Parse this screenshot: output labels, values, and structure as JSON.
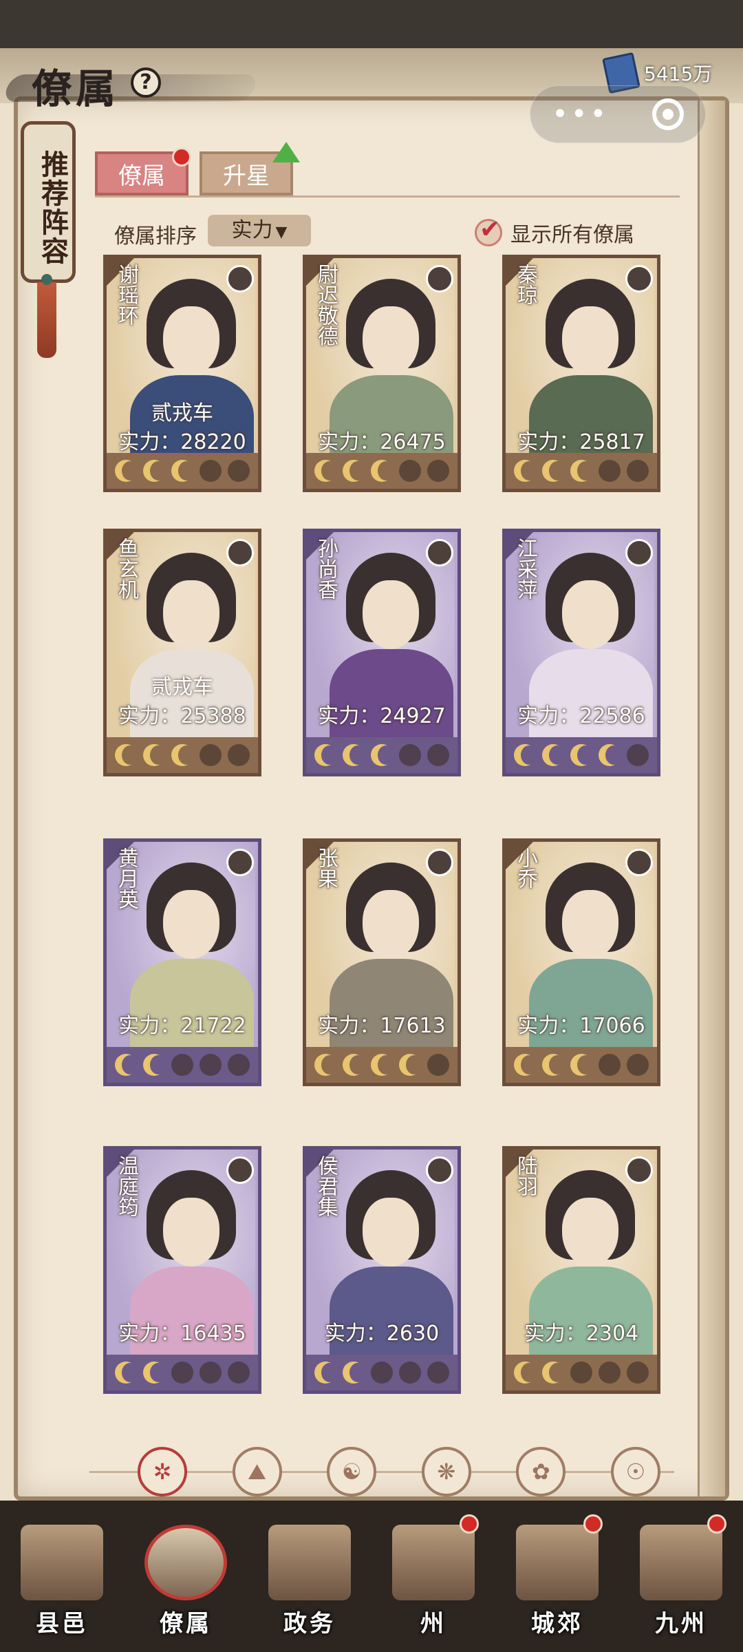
{
  "header": {
    "title": "僚属",
    "help_symbol": "?",
    "currency_value": "5415万",
    "capsule_dots": "•••"
  },
  "recommend_banner": "推荐阵容",
  "tabs": [
    {
      "label": "僚属",
      "active": true,
      "badge": "red-dot"
    },
    {
      "label": "升星",
      "active": false,
      "badge": "green-arrow"
    }
  ],
  "sort": {
    "label": "僚属排序",
    "selected": "实力"
  },
  "show_all": {
    "label": "显示所有僚属",
    "checked": true
  },
  "cards": [
    {
      "name": "谢瑶环",
      "tag": "贰戎车",
      "power": "实力：28220",
      "rarity": "gold",
      "stars_lit": 3,
      "stars_total": 5,
      "robe": "#3b4e7a"
    },
    {
      "name": "尉迟敬德",
      "tag": "",
      "power": "实力：26475",
      "rarity": "gold",
      "stars_lit": 3,
      "stars_total": 5,
      "robe": "#8a9a7c"
    },
    {
      "name": "秦琼",
      "tag": "",
      "power": "实力：25817",
      "rarity": "gold",
      "stars_lit": 3,
      "stars_total": 5,
      "robe": "#5a6b53"
    },
    {
      "name": "鱼玄机",
      "tag": "贰戎车",
      "power": "实力：25388",
      "rarity": "gold",
      "stars_lit": 3,
      "stars_total": 5,
      "robe": "#e8e0d8"
    },
    {
      "name": "孙尚香",
      "tag": "",
      "power": "实力：24927",
      "rarity": "purple",
      "stars_lit": 3,
      "stars_total": 5,
      "robe": "#6d4a8a"
    },
    {
      "name": "江采萍",
      "tag": "",
      "power": "实力：22586",
      "rarity": "purple",
      "stars_lit": 4,
      "stars_total": 5,
      "robe": "#e6dcea"
    },
    {
      "name": "黄月英",
      "tag": "",
      "power": "实力：21722",
      "rarity": "purple",
      "stars_lit": 2,
      "stars_total": 5,
      "robe": "#c8c59a"
    },
    {
      "name": "张果",
      "tag": "",
      "power": "实力：17613",
      "rarity": "gold",
      "stars_lit": 4,
      "stars_total": 5,
      "robe": "#8f8676"
    },
    {
      "name": "小乔",
      "tag": "",
      "power": "实力：17066",
      "rarity": "gold",
      "stars_lit": 3,
      "stars_total": 5,
      "robe": "#7fa594"
    },
    {
      "name": "温庭筠",
      "tag": "",
      "power": "实力：16435",
      "rarity": "purple",
      "stars_lit": 2,
      "stars_total": 5,
      "robe": "#d8a6c6"
    },
    {
      "name": "侯君集",
      "tag": "",
      "power": "实力：2630",
      "rarity": "purple",
      "stars_lit": 2,
      "stars_total": 5,
      "robe": "#5b5a8a"
    },
    {
      "name": "陆羽",
      "tag": "",
      "power": "实力：2304",
      "rarity": "gold",
      "stars_lit": 2,
      "stars_total": 5,
      "robe": "#8fb79c"
    }
  ],
  "filters": [
    {
      "icon": "all-filter-icon",
      "glyph": "✲",
      "active": true
    },
    {
      "icon": "mountain-filter-icon",
      "glyph": "⛰",
      "active": false
    },
    {
      "icon": "cat-filter-icon",
      "glyph": "☯",
      "active": false
    },
    {
      "icon": "fan-filter-icon",
      "glyph": "❋",
      "active": false
    },
    {
      "icon": "lion-filter-icon",
      "glyph": "✿",
      "active": false
    },
    {
      "icon": "mask-filter-icon",
      "glyph": "☉",
      "active": false
    }
  ],
  "bottom_nav": [
    {
      "label": "县邑",
      "active": false,
      "badge": false
    },
    {
      "label": "僚属",
      "active": true,
      "badge": false
    },
    {
      "label": "政务",
      "active": false,
      "badge": false
    },
    {
      "label": "州",
      "active": false,
      "badge": true
    },
    {
      "label": "城郊",
      "active": false,
      "badge": true
    },
    {
      "label": "九州",
      "active": false,
      "badge": true
    }
  ],
  "colors": {
    "accent_red": "#c23a35",
    "gold_card": "#e3cda5",
    "purple_card": "#b8a7cf"
  }
}
